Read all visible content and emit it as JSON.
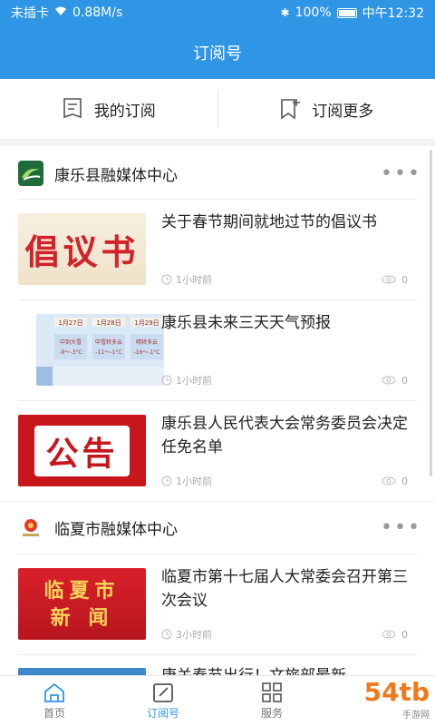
{
  "status_bar": {
    "carrier": "未插卡",
    "speed": "0.88M/s",
    "battery": "100%",
    "time": "中午12:32"
  },
  "header": {
    "title": "订阅号"
  },
  "subscribe_bar": {
    "my_subscriptions": "我的订阅",
    "subscribe_more": "订阅更多"
  },
  "channels": [
    {
      "name": "康乐县融媒体中心",
      "more": "•••",
      "articles": [
        {
          "title": "关于春节期间就地过节的倡议书",
          "time": "1小时前",
          "views": "0",
          "thumb_text": "倡议书"
        },
        {
          "title": "康乐县未来三天天气预报",
          "time": "1小时前",
          "views": "0",
          "thumb_text": ""
        },
        {
          "title": "康乐县人民代表大会常务委员会决定任免名单",
          "time": "1小时前",
          "views": "0",
          "thumb_text": "公告"
        }
      ]
    },
    {
      "name": "临夏市融媒体中心",
      "more": "•••",
      "articles": [
        {
          "title": "临夏市第十七届人大常委会召开第三次会议",
          "time": "3小时前",
          "views": "0",
          "thumb_text_1": "临夏市",
          "thumb_text_2": "新 闻"
        },
        {
          "title": "康关春节出行！文旅部最新"
        }
      ]
    }
  ],
  "weather_thumb": {
    "dates": [
      "1月27日",
      "1月28日",
      "1月29日"
    ],
    "conditions": [
      "中到大雪",
      "中雪转多云",
      "晴转多云"
    ],
    "temps": [
      "-9～-3°C",
      "-11～-1°C",
      "-16～-1°C"
    ]
  },
  "bottom_nav": [
    {
      "label": "首页",
      "icon": "home-icon"
    },
    {
      "label": "订阅号",
      "icon": "edit-icon"
    },
    {
      "label": "服务",
      "icon": "grid-icon"
    }
  ],
  "watermark": {
    "main": "54tb",
    "sub": "手游网"
  },
  "colors": {
    "brand": "#2f96e6",
    "notice_red": "#c8161d"
  }
}
